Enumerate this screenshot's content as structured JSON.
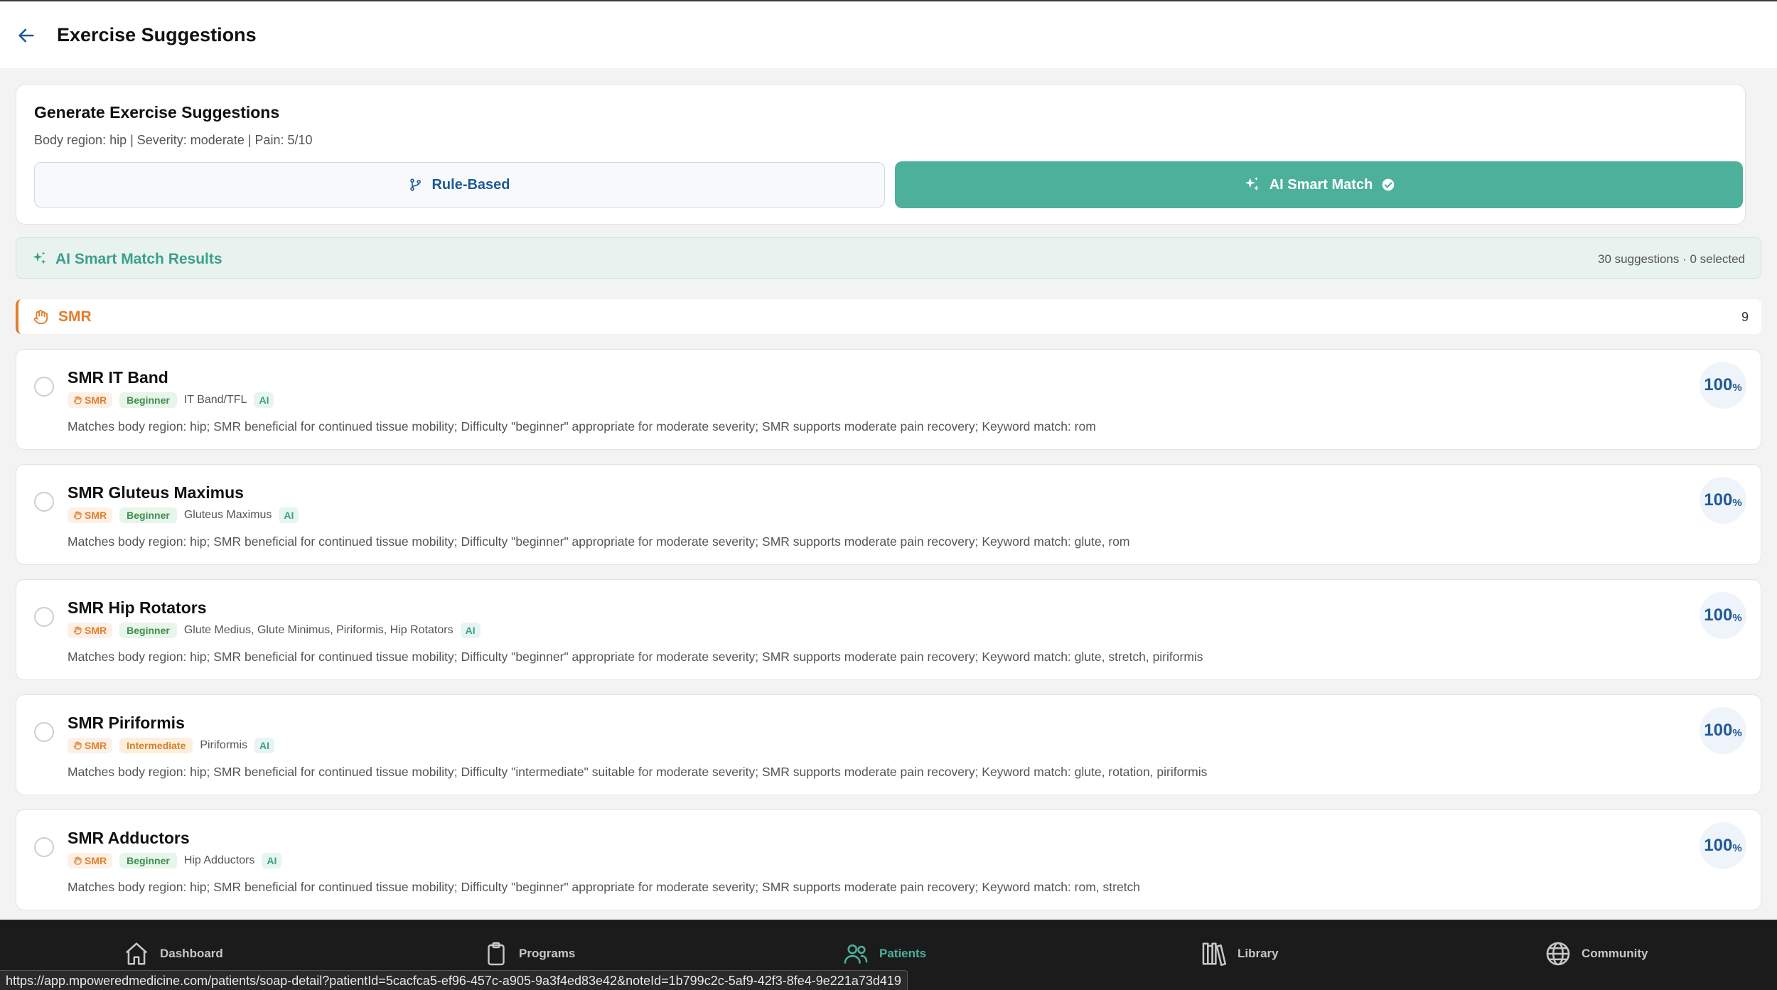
{
  "header": {
    "title": "Exercise Suggestions",
    "back_icon": "arrow-left-icon"
  },
  "generate": {
    "title": "Generate Exercise Suggestions",
    "subtitle": "Body region: hip | Severity: moderate | Pain: 5/10",
    "rule_based_label": "Rule-Based",
    "ai_label": "AI Smart Match"
  },
  "results": {
    "title": "AI Smart Match Results",
    "count_text": "30 suggestions · 0 selected"
  },
  "group": {
    "label": "SMR",
    "count": "9"
  },
  "exercises": [
    {
      "name": "SMR IT Band",
      "category": "SMR",
      "difficulty": "Beginner",
      "muscles": "IT Band/TFL",
      "ai": "AI",
      "description": "Matches body region: hip; SMR beneficial for continued tissue mobility; Difficulty \"beginner\" appropriate for moderate severity; SMR supports moderate pain recovery; Keyword match: rom",
      "score": "100",
      "score_unit": "%"
    },
    {
      "name": "SMR Gluteus Maximus",
      "category": "SMR",
      "difficulty": "Beginner",
      "muscles": "Gluteus Maximus",
      "ai": "AI",
      "description": "Matches body region: hip; SMR beneficial for continued tissue mobility; Difficulty \"beginner\" appropriate for moderate severity; SMR supports moderate pain recovery; Keyword match: glute, rom",
      "score": "100",
      "score_unit": "%"
    },
    {
      "name": "SMR Hip Rotators",
      "category": "SMR",
      "difficulty": "Beginner",
      "muscles": "Glute Medius, Glute Minimus, Piriformis, Hip Rotators",
      "ai": "AI",
      "description": "Matches body region: hip; SMR beneficial for continued tissue mobility; Difficulty \"beginner\" appropriate for moderate severity; SMR supports moderate pain recovery; Keyword match: glute, stretch, piriformis",
      "score": "100",
      "score_unit": "%"
    },
    {
      "name": "SMR Piriformis",
      "category": "SMR",
      "difficulty": "Intermediate",
      "muscles": "Piriformis",
      "ai": "AI",
      "description": "Matches body region: hip; SMR beneficial for continued tissue mobility; Difficulty \"intermediate\" suitable for moderate severity; SMR supports moderate pain recovery; Keyword match: glute, rotation, piriformis",
      "score": "100",
      "score_unit": "%"
    },
    {
      "name": "SMR Adductors",
      "category": "SMR",
      "difficulty": "Beginner",
      "muscles": "Hip Adductors",
      "ai": "AI",
      "description": "Matches body region: hip; SMR beneficial for continued tissue mobility; Difficulty \"beginner\" appropriate for moderate severity; SMR supports moderate pain recovery; Keyword match: rom, stretch",
      "score": "100",
      "score_unit": "%"
    }
  ],
  "nav": [
    {
      "label": "Dashboard",
      "icon": "home-icon"
    },
    {
      "label": "Programs",
      "icon": "clipboard-icon"
    },
    {
      "label": "Patients",
      "icon": "users-icon",
      "active": true
    },
    {
      "label": "Library",
      "icon": "library-icon"
    },
    {
      "label": "Community",
      "icon": "globe-icon"
    }
  ],
  "status_url": "https://app.mpoweredmedicine.com/patients/soap-detail?patientId=5cacfca5-ef96-457c-a905-9a3f4ed83e42&noteId=1b799c2c-5af9-42f3-8fe4-9e221a73d419",
  "colors": {
    "accent": "#4db09b",
    "primary": "#1f5a96",
    "smr": "#e07f2b",
    "beginner": "#3f8f4e",
    "intermediate": "#d4801f"
  }
}
